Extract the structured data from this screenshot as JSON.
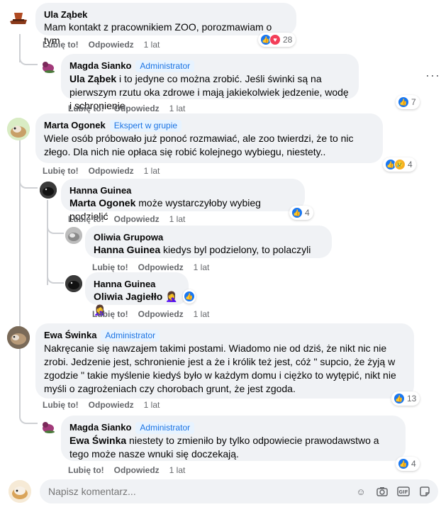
{
  "actions": {
    "like": "Lubię to!",
    "reply": "Odpowiedz",
    "time": "1 lat"
  },
  "comments": [
    {
      "author": "Ula Ząbek",
      "text": "Mam kontakt z pracownikiem ZOO, porozmawiam o tym",
      "reactions": {
        "icons": [
          "like-icon",
          "heart-icon"
        ],
        "count": "28"
      }
    },
    {
      "author": "Magda Sianko",
      "badge": "Administrator",
      "mention": "Ula Ząbek",
      "text": " i to jedyne co można zrobić. Jeśli świnki są na pierwszym rzutu oka zdrowe i mają jakiekolwiek jedzenie, wodę i schronienie.",
      "reactions": {
        "icons": [
          "like-icon"
        ],
        "count": "7"
      }
    },
    {
      "author": "Marta Ogonek",
      "badge": "Ekspert w grupie",
      "text": "Wiele osób próbowało już ponoć rozmawiać, ale zoo twierdzi, że to nic złego. Dla nich nie opłaca się robić kolejnego wybiegu, niestety..",
      "reactions": {
        "icons": [
          "like-icon",
          "sad-icon"
        ],
        "count": "4"
      }
    },
    {
      "author": "Hanna Guinea",
      "mention": "Marta Ogonek",
      "text": " może wystarczyłoby wybieg podzielić",
      "reactions": {
        "icons": [
          "like-icon"
        ],
        "count": "4"
      }
    },
    {
      "author": "Oliwia Grupowa",
      "mention": "Hanna Guinea",
      "text": " kiedys byl podzielony, to polaczyli"
    },
    {
      "author": "Hanna Guinea",
      "mention": "Oliwia Jagiełło",
      "text": " 🤦‍♀️🤦‍♀️",
      "reactions": {
        "icons": [
          "like-icon"
        ],
        "count": ""
      }
    },
    {
      "author": "Ewa Świnka",
      "badge": "Administrator",
      "text": "Nakręcanie się nawzajem takimi postami. Wiadomo nie od dziś, że nikt nic nie zrobi. Jedzenie jest, schronienie jest a że i królik też jest, cóż \" supcio, że żyją w zgodzie \" takie myślenie kiedyś było w każdym domu i ciężko to wytępić, nikt nie myśli o zagrożeniach czy chorobach grunt, że jest zgoda.",
      "reactions": {
        "icons": [
          "like-icon"
        ],
        "count": "13"
      }
    },
    {
      "author": "Magda Sianko",
      "badge": "Administrator",
      "mention": "Ewa Świnka",
      "text": " niestety to zmieniło by tylko odpowiecie prawodawstwo a tego może nasze wnuki się doczekają.",
      "reactions": {
        "icons": [
          "like-icon"
        ],
        "count": "4"
      }
    }
  ],
  "composer": {
    "placeholder": "Napisz komentarz..."
  },
  "icons": {
    "more": "more-options-icon"
  }
}
